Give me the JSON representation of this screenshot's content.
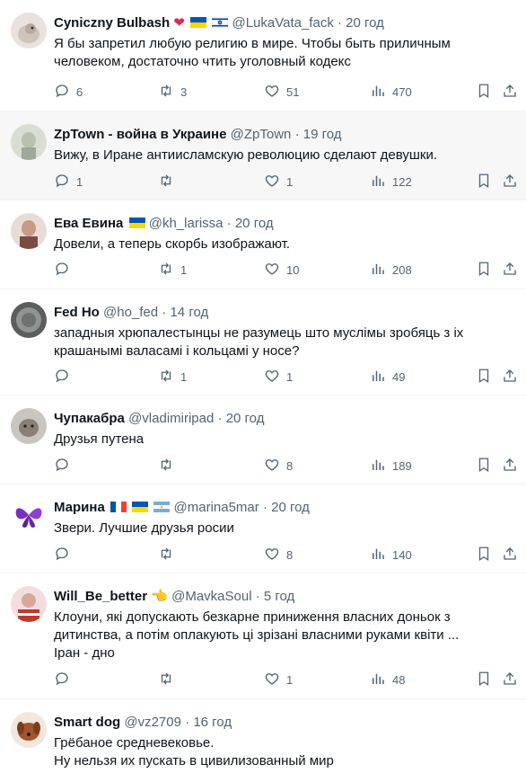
{
  "tweets": [
    {
      "name": "Cyniczny Bulbash",
      "handle": "@LukaVata_fack",
      "sep": "·",
      "time": "20 год",
      "lines": [
        "Я бы запретил любую религию в мире. Чтобы быть приличным",
        "человеком, достаточно чтить уголовный кодекс"
      ],
      "replies": "6",
      "retweets": "3",
      "likes": "51",
      "views": "470"
    },
    {
      "name": "ZpTown - война в Украине",
      "handle": "@ZpTown",
      "sep": "·",
      "time": "19 год",
      "lines": [
        "Вижу, в Иране антиисламскую революцию сделают девушки."
      ],
      "replies": "1",
      "retweets": "",
      "likes": "1",
      "views": "122"
    },
    {
      "name": "Ева Евина",
      "handle": "@kh_larissa",
      "sep": "·",
      "time": "20 год",
      "lines": [
        "Довели, а теперь скорбь изображают."
      ],
      "replies": "",
      "retweets": "1",
      "likes": "10",
      "views": "208"
    },
    {
      "name": "Fed Ho",
      "handle": "@ho_fed",
      "sep": "·",
      "time": "14 год",
      "lines": [
        "западныя хрюпалестынцы не разумець што муслімы зробяць з іх",
        "крашанымі валасамі і кольцамі у носе?"
      ],
      "replies": "",
      "retweets": "1",
      "likes": "1",
      "views": "49"
    },
    {
      "name": "Чупакабра",
      "handle": "@vladimiripad",
      "sep": "·",
      "time": "20 год",
      "lines": [
        "Друзья путена"
      ],
      "replies": "",
      "retweets": "",
      "likes": "8",
      "views": "189"
    },
    {
      "name": "Марина",
      "handle": "@marina5mar",
      "sep": "·",
      "time": "20 год",
      "lines": [
        "Звери. Лучшие друзья росии"
      ],
      "replies": "",
      "retweets": "",
      "likes": "8",
      "views": "140"
    },
    {
      "name": "Will_Be_better",
      "handle": "@MavkaSoul",
      "sep": "·",
      "time": "5 год",
      "lines": [
        "Клоуни, які допускають безкарне приниження власних доньок з",
        "дитинства, а потім оплакують ці зрізані власними руками квіти ...",
        "Іран - дно"
      ],
      "replies": "",
      "retweets": "",
      "likes": "1",
      "views": "48"
    },
    {
      "name": "Smart dog",
      "handle": "@vz2709",
      "sep": "·",
      "time": "16 год",
      "lines": [
        "Грёбаное средневековье.",
        "Ну нельзя их пускать в цивилизованный мир"
      ],
      "replies": "",
      "retweets": "",
      "likes": "",
      "views": ""
    }
  ],
  "icons": {
    "reply": "reply-icon",
    "retweet": "retweet-icon",
    "like": "heart-icon",
    "views": "views-icon",
    "bookmark": "bookmark-icon",
    "share": "share-icon"
  }
}
